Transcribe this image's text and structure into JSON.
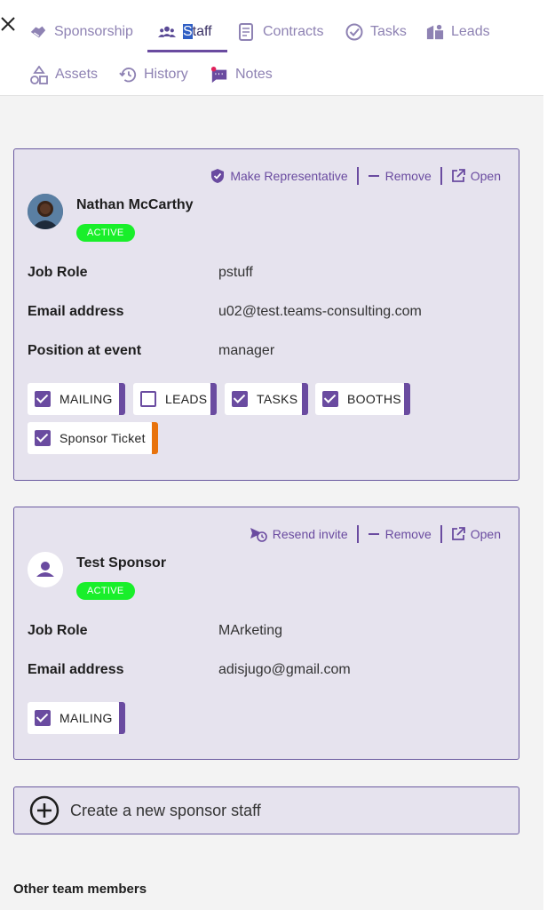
{
  "close_label": "×",
  "tabs": [
    {
      "label": "Sponsorship",
      "icon": "handshake-icon"
    },
    {
      "label_pre": "S",
      "label_post": "taff",
      "icon": "people-icon",
      "active": true
    },
    {
      "label": "Contracts",
      "icon": "document-icon"
    },
    {
      "label": "Tasks",
      "icon": "check-circle-icon"
    },
    {
      "label": "Leads",
      "icon": "leads-icon"
    },
    {
      "label": "Assets",
      "icon": "shapes-icon"
    },
    {
      "label": "History",
      "icon": "history-icon"
    },
    {
      "label": "Notes",
      "icon": "chat-icon"
    }
  ],
  "staff": [
    {
      "name": "Nathan McCarthy",
      "status": "ACTIVE",
      "actions": [
        "Make Representative",
        "Remove",
        "Open"
      ],
      "fields": [
        {
          "label": "Job Role",
          "value": "pstuff"
        },
        {
          "label": "Email address",
          "value": "u02@test.teams-consulting.com"
        },
        {
          "label": "Position at event",
          "value": "manager"
        }
      ],
      "chips": [
        {
          "label": "MAILING",
          "checked": true
        },
        {
          "label": "LEADS",
          "checked": false
        },
        {
          "label": "TASKS",
          "checked": true
        },
        {
          "label": "BOOTHS",
          "checked": true
        },
        {
          "label": "Sponsor Ticket",
          "checked": true
        }
      ]
    },
    {
      "name": "Test Sponsor",
      "status": "ACTIVE",
      "actions": [
        "Resend invite",
        "Remove",
        "Open"
      ],
      "fields": [
        {
          "label": "Job Role",
          "value": "MArketing"
        },
        {
          "label": "Email address",
          "value": "adisjugo@gmail.com"
        }
      ],
      "chips": [
        {
          "label": "MAILING",
          "checked": true
        }
      ]
    }
  ],
  "create_label": "Create a new sponsor staff",
  "other_heading": "Other team members",
  "colors": {
    "accent": "#6a4ba0",
    "active_badge": "#19ef2a",
    "ticket_bar": "#e8730c",
    "tab": "#8e82b3"
  }
}
